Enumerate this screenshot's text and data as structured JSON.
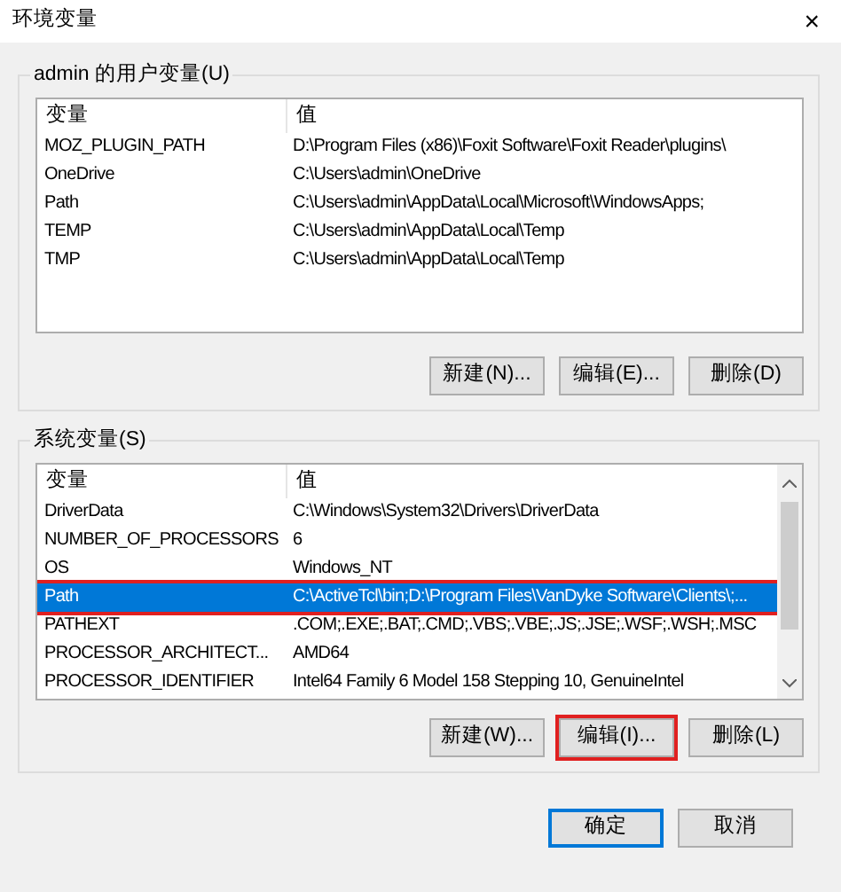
{
  "window": {
    "title": "环境变量",
    "close": "×"
  },
  "user_variables": {
    "label": "admin 的用户变量(U)",
    "columns": [
      "变量",
      "值"
    ],
    "rows": [
      {
        "variable": "MOZ_PLUGIN_PATH",
        "value": "D:\\Program Files (x86)\\Foxit Software\\Foxit Reader\\plugins\\",
        "selected": false
      },
      {
        "variable": "OneDrive",
        "value": "C:\\Users\\admin\\OneDrive",
        "selected": false
      },
      {
        "variable": "Path",
        "value": "C:\\Users\\admin\\AppData\\Local\\Microsoft\\WindowsApps;",
        "selected": false
      },
      {
        "variable": "TEMP",
        "value": "C:\\Users\\admin\\AppData\\Local\\Temp",
        "selected": false
      },
      {
        "variable": "TMP",
        "value": "C:\\Users\\admin\\AppData\\Local\\Temp",
        "selected": false
      }
    ],
    "buttons": [
      {
        "label": "新建(N)..."
      },
      {
        "label": "编辑(E)..."
      },
      {
        "label": "删除(D)"
      }
    ]
  },
  "system_variables": {
    "label": "系统变量(S)",
    "columns": [
      "变量",
      "值"
    ],
    "rows": [
      {
        "variable": "DriverData",
        "value": "C:\\Windows\\System32\\Drivers\\DriverData",
        "selected": false,
        "annotated": false
      },
      {
        "variable": "NUMBER_OF_PROCESSORS",
        "value": "6",
        "selected": false,
        "annotated": false
      },
      {
        "variable": "OS",
        "value": "Windows_NT",
        "selected": false,
        "annotated": false
      },
      {
        "variable": "Path",
        "value": "C:\\ActiveTcl\\bin;D:\\Program Files\\VanDyke Software\\Clients\\;...",
        "selected": true,
        "annotated": true
      },
      {
        "variable": "PATHEXT",
        "value": ".COM;.EXE;.BAT;.CMD;.VBS;.VBE;.JS;.JSE;.WSF;.WSH;.MSC",
        "selected": false,
        "annotated": false
      },
      {
        "variable": "PROCESSOR_ARCHITECT...",
        "value": "AMD64",
        "selected": false,
        "annotated": false
      },
      {
        "variable": "PROCESSOR_IDENTIFIER",
        "value": "Intel64 Family 6 Model 158 Stepping 10, GenuineIntel",
        "selected": false,
        "annotated": false
      }
    ],
    "buttons": [
      {
        "label": "新建(W)...",
        "annotated": false
      },
      {
        "label": "编辑(I)...",
        "annotated": true
      },
      {
        "label": "删除(L)",
        "annotated": false
      }
    ]
  },
  "dialog_buttons": [
    {
      "label": "确定",
      "default": true
    },
    {
      "label": "取消",
      "default": false
    }
  ]
}
